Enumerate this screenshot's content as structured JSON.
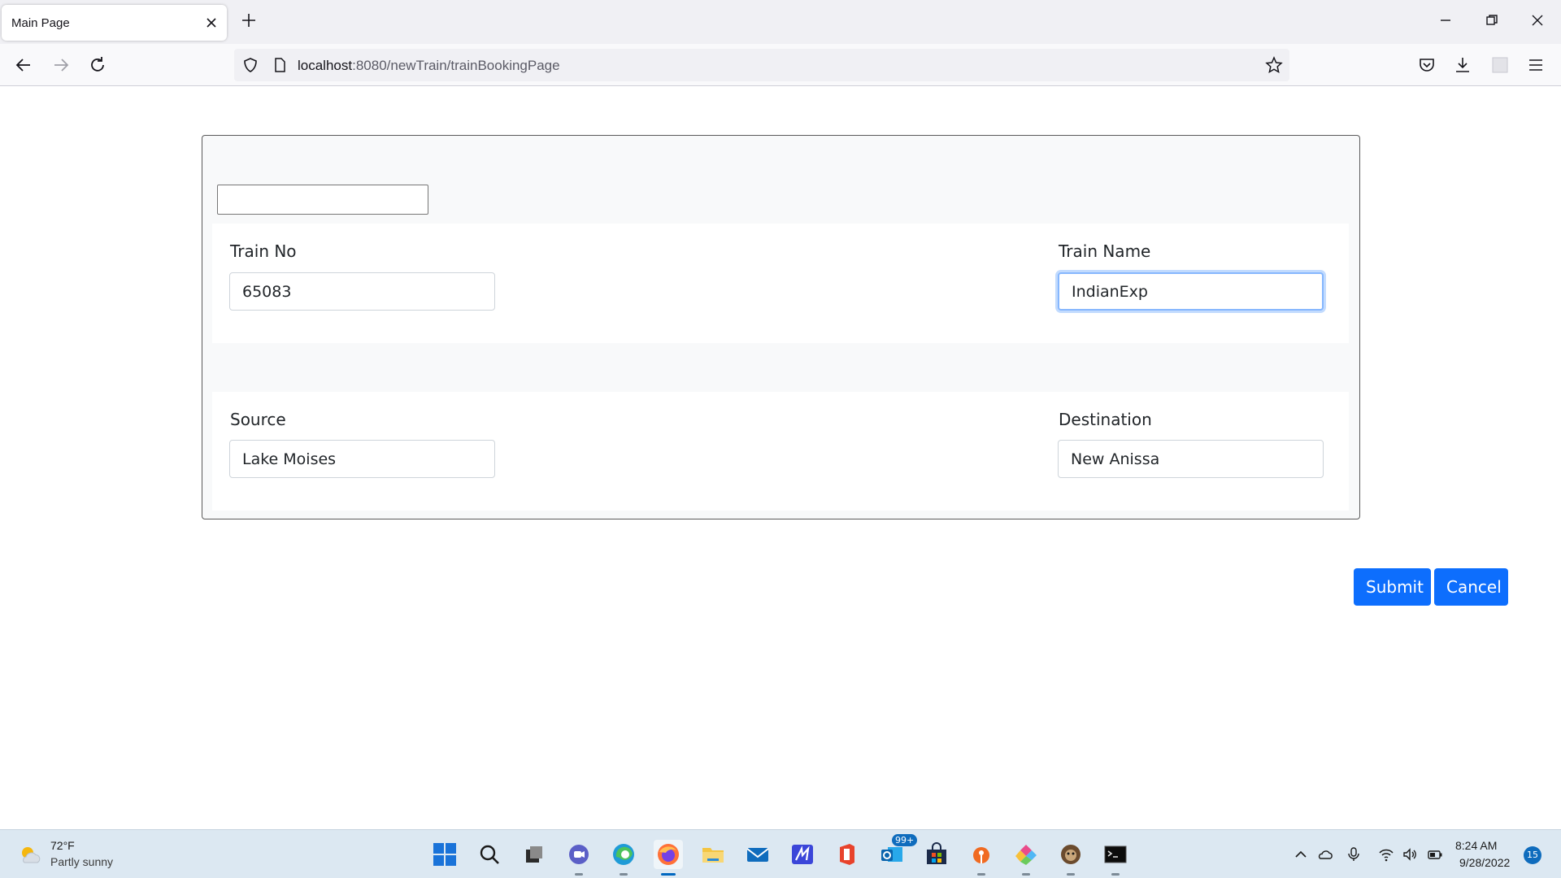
{
  "browser": {
    "tab_title": "Main Page",
    "url_host": "localhost",
    "url_path": ":8080/newTrain/trainBookingPage"
  },
  "form": {
    "search_value": "",
    "train_no_label": "Train No",
    "train_no_value": "65083",
    "train_name_label": "Train Name",
    "train_name_value": "IndianExp",
    "source_label": "Source",
    "source_value": "Lake Moises",
    "destination_label": "Destination",
    "destination_value": "New Anissa",
    "submit_label": "Submit",
    "cancel_label": "Cancel",
    "button_color": "#0d6efd"
  },
  "taskbar": {
    "weather_temp": "72°F",
    "weather_desc": "Partly sunny",
    "mail_badge": "99+",
    "clock_time": "8:24 AM",
    "clock_date": "9/28/2022",
    "notification_count": "15",
    "apps": [
      "windows-start",
      "search",
      "task-view",
      "chat",
      "edge",
      "firefox",
      "file-explorer",
      "mail",
      "app-m",
      "office",
      "outlook",
      "store",
      "app-orange",
      "app-colorful",
      "app-animal",
      "terminal"
    ]
  }
}
